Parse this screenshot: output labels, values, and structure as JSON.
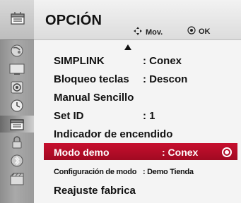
{
  "header": {
    "title": "OPCIÓN",
    "move_hint": "Mov.",
    "ok_hint": "OK"
  },
  "sidebar": {
    "items": [
      {
        "icon": "picture-menu-icon"
      },
      {
        "icon": "satellite-dish-icon"
      },
      {
        "icon": "screen-icon"
      },
      {
        "icon": "audio-icon"
      },
      {
        "icon": "clock-icon"
      },
      {
        "icon": "option-menu-icon"
      },
      {
        "icon": "lock-icon"
      },
      {
        "icon": "input-icon"
      },
      {
        "icon": "usb-icon"
      }
    ],
    "active_index": 5
  },
  "menu": {
    "items": [
      {
        "label": "SIMPLINK",
        "value": ": Conex"
      },
      {
        "label": "Bloqueo teclas",
        "value": ": Descon"
      },
      {
        "label": "Manual Sencillo",
        "value": ""
      },
      {
        "label": "Set ID",
        "value": ": 1"
      },
      {
        "label": "Indicador de encendido",
        "value": ""
      },
      {
        "label": "Modo demo",
        "value": ": Conex"
      },
      {
        "label": "Configuración de modo",
        "value": ": Demo Tienda"
      },
      {
        "label": "Reajuste fabrica",
        "value": ""
      }
    ],
    "selected_index": 5
  },
  "colors": {
    "selection": "#b50c27",
    "sidebar": "#a0a0a0"
  }
}
